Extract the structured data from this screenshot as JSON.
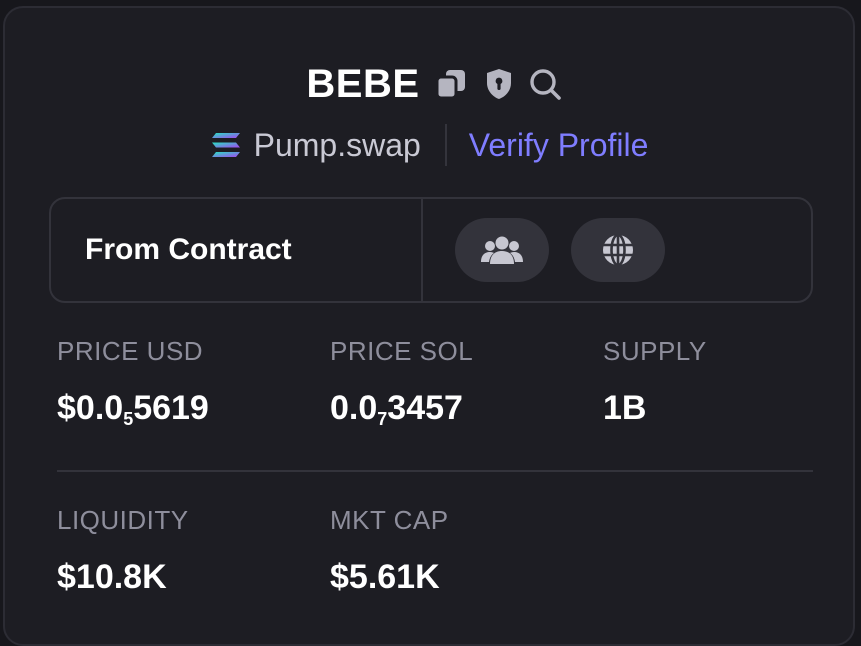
{
  "token": {
    "name": "BEBE",
    "dex": "Pump.swap",
    "verify_label": "Verify Profile"
  },
  "info": {
    "source_label": "From Contract"
  },
  "stats": {
    "price_usd": {
      "label": "PRICE USD",
      "prefix": "$0.0",
      "zeros": "5",
      "digits": "5619"
    },
    "price_sol": {
      "label": "PRICE SOL",
      "prefix": "0.0",
      "zeros": "7",
      "digits": "3457"
    },
    "supply": {
      "label": "SUPPLY",
      "value": "1B"
    },
    "liquidity": {
      "label": "LIQUIDITY",
      "value": "$10.8K"
    },
    "mkt_cap": {
      "label": "MKT CAP",
      "value": "$5.61K"
    }
  },
  "icons": {
    "copy": "copy-icon",
    "shield": "shield-icon",
    "search": "search-icon",
    "dex": "solana-icon",
    "community": "users-icon",
    "website": "globe-icon"
  },
  "colors": {
    "accent": "#7f7dff",
    "background": "#1d1d23",
    "muted": "#8e8e9c"
  }
}
